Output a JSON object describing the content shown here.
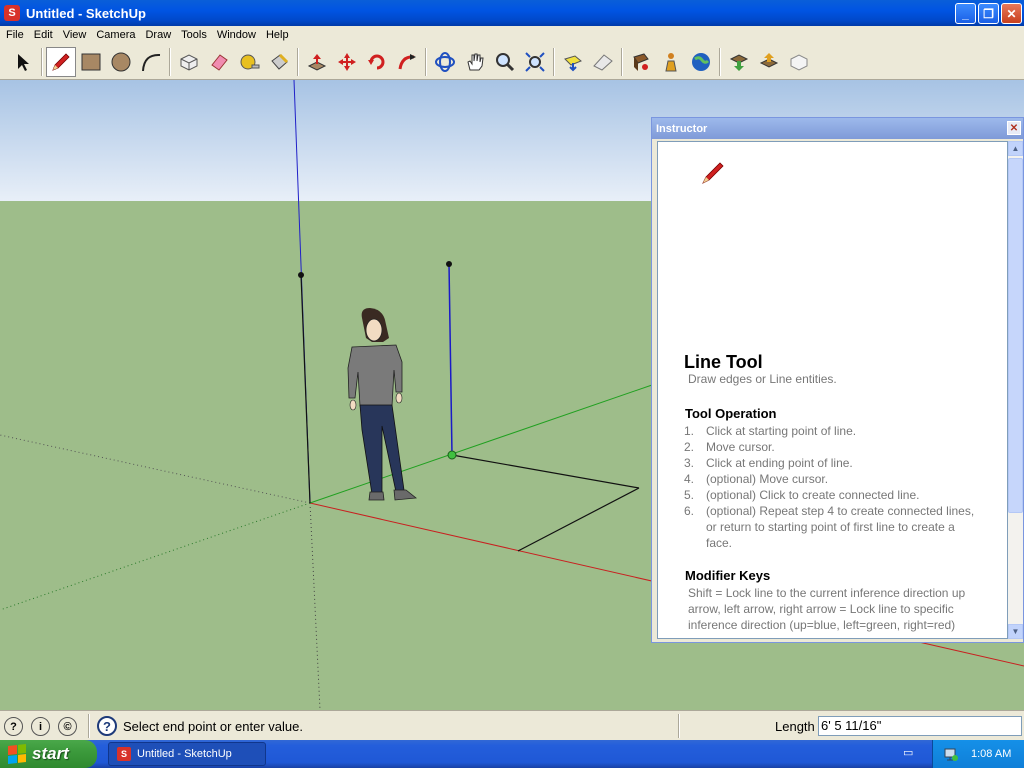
{
  "window": {
    "title": "Untitled - SketchUp"
  },
  "menu": [
    "File",
    "Edit",
    "View",
    "Camera",
    "Draw",
    "Tools",
    "Window",
    "Help"
  ],
  "toolbar": {
    "tools": [
      "select",
      "line",
      "rectangle",
      "circle",
      "arc",
      "make-component",
      "eraser",
      "tape-measure",
      "paint-bucket",
      "push-pull",
      "move",
      "rotate",
      "follow-me",
      "orbit",
      "pan",
      "zoom",
      "zoom-extents",
      "add-location",
      "toggle-terrain",
      "get-models",
      "share-model",
      "upload-component",
      "google-earth",
      "get-models-2",
      "share-model-2",
      "add-to-sketchup"
    ],
    "active_tool": "line"
  },
  "instructor": {
    "title": "Instructor",
    "tool_name": "Line Tool",
    "tool_desc": "Draw edges or Line entities.",
    "operation_heading": "Tool Operation",
    "steps": [
      {
        "num": "1.",
        "text": "Click at starting point of line."
      },
      {
        "num": "2.",
        "text": "Move cursor."
      },
      {
        "num": "3.",
        "text": "Click at ending point of line."
      },
      {
        "num": "4.",
        "text": "(optional) Move cursor."
      },
      {
        "num": "5.",
        "text": "(optional) Click to create connected line."
      },
      {
        "num": "6.",
        "text": "(optional) Repeat step 4 to create connected lines, or return to starting point of first line to create a face."
      }
    ],
    "modifier_heading": "Modifier Keys",
    "modifier_text": "Shift = Lock line to the current inference direction up arrow, left arrow, right arrow = Lock line to specific inference direction (up=blue, left=green, right=red)"
  },
  "status": {
    "message": "Select end point or enter value.",
    "vcb_label": "Length",
    "vcb_value": "6' 5 11/16\""
  },
  "taskbar": {
    "start_label": "start",
    "task_label": "Untitled - SketchUp",
    "clock": "1:08 AM"
  },
  "colors": {
    "sky_top": "#a8c4e6",
    "sky_bottom": "#e6eef8",
    "ground": "#9ebe8a",
    "red_axis": "#c82020",
    "green_axis": "#20a020",
    "blue_axis": "#2020c8"
  }
}
